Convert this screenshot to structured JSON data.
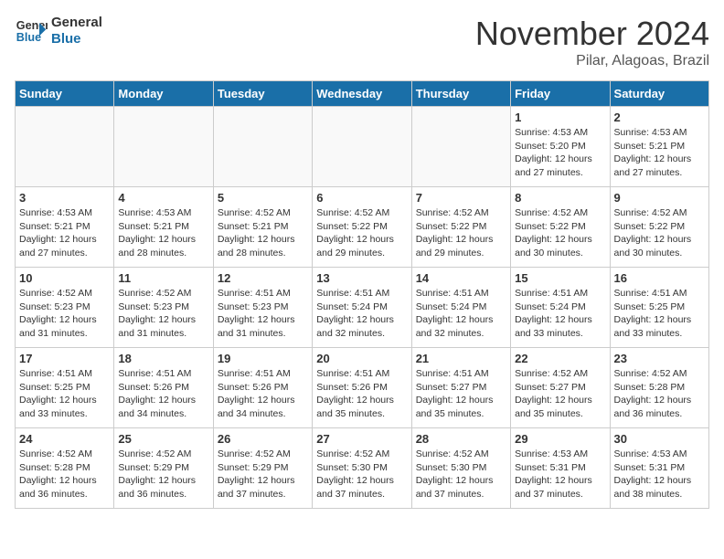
{
  "header": {
    "logo_line1": "General",
    "logo_line2": "Blue",
    "month": "November 2024",
    "location": "Pilar, Alagoas, Brazil"
  },
  "days_of_week": [
    "Sunday",
    "Monday",
    "Tuesday",
    "Wednesday",
    "Thursday",
    "Friday",
    "Saturday"
  ],
  "weeks": [
    [
      {
        "day": "",
        "info": ""
      },
      {
        "day": "",
        "info": ""
      },
      {
        "day": "",
        "info": ""
      },
      {
        "day": "",
        "info": ""
      },
      {
        "day": "",
        "info": ""
      },
      {
        "day": "1",
        "info": "Sunrise: 4:53 AM\nSunset: 5:20 PM\nDaylight: 12 hours and 27 minutes."
      },
      {
        "day": "2",
        "info": "Sunrise: 4:53 AM\nSunset: 5:21 PM\nDaylight: 12 hours and 27 minutes."
      }
    ],
    [
      {
        "day": "3",
        "info": "Sunrise: 4:53 AM\nSunset: 5:21 PM\nDaylight: 12 hours and 27 minutes."
      },
      {
        "day": "4",
        "info": "Sunrise: 4:53 AM\nSunset: 5:21 PM\nDaylight: 12 hours and 28 minutes."
      },
      {
        "day": "5",
        "info": "Sunrise: 4:52 AM\nSunset: 5:21 PM\nDaylight: 12 hours and 28 minutes."
      },
      {
        "day": "6",
        "info": "Sunrise: 4:52 AM\nSunset: 5:22 PM\nDaylight: 12 hours and 29 minutes."
      },
      {
        "day": "7",
        "info": "Sunrise: 4:52 AM\nSunset: 5:22 PM\nDaylight: 12 hours and 29 minutes."
      },
      {
        "day": "8",
        "info": "Sunrise: 4:52 AM\nSunset: 5:22 PM\nDaylight: 12 hours and 30 minutes."
      },
      {
        "day": "9",
        "info": "Sunrise: 4:52 AM\nSunset: 5:22 PM\nDaylight: 12 hours and 30 minutes."
      }
    ],
    [
      {
        "day": "10",
        "info": "Sunrise: 4:52 AM\nSunset: 5:23 PM\nDaylight: 12 hours and 31 minutes."
      },
      {
        "day": "11",
        "info": "Sunrise: 4:52 AM\nSunset: 5:23 PM\nDaylight: 12 hours and 31 minutes."
      },
      {
        "day": "12",
        "info": "Sunrise: 4:51 AM\nSunset: 5:23 PM\nDaylight: 12 hours and 31 minutes."
      },
      {
        "day": "13",
        "info": "Sunrise: 4:51 AM\nSunset: 5:24 PM\nDaylight: 12 hours and 32 minutes."
      },
      {
        "day": "14",
        "info": "Sunrise: 4:51 AM\nSunset: 5:24 PM\nDaylight: 12 hours and 32 minutes."
      },
      {
        "day": "15",
        "info": "Sunrise: 4:51 AM\nSunset: 5:24 PM\nDaylight: 12 hours and 33 minutes."
      },
      {
        "day": "16",
        "info": "Sunrise: 4:51 AM\nSunset: 5:25 PM\nDaylight: 12 hours and 33 minutes."
      }
    ],
    [
      {
        "day": "17",
        "info": "Sunrise: 4:51 AM\nSunset: 5:25 PM\nDaylight: 12 hours and 33 minutes."
      },
      {
        "day": "18",
        "info": "Sunrise: 4:51 AM\nSunset: 5:26 PM\nDaylight: 12 hours and 34 minutes."
      },
      {
        "day": "19",
        "info": "Sunrise: 4:51 AM\nSunset: 5:26 PM\nDaylight: 12 hours and 34 minutes."
      },
      {
        "day": "20",
        "info": "Sunrise: 4:51 AM\nSunset: 5:26 PM\nDaylight: 12 hours and 35 minutes."
      },
      {
        "day": "21",
        "info": "Sunrise: 4:51 AM\nSunset: 5:27 PM\nDaylight: 12 hours and 35 minutes."
      },
      {
        "day": "22",
        "info": "Sunrise: 4:52 AM\nSunset: 5:27 PM\nDaylight: 12 hours and 35 minutes."
      },
      {
        "day": "23",
        "info": "Sunrise: 4:52 AM\nSunset: 5:28 PM\nDaylight: 12 hours and 36 minutes."
      }
    ],
    [
      {
        "day": "24",
        "info": "Sunrise: 4:52 AM\nSunset: 5:28 PM\nDaylight: 12 hours and 36 minutes."
      },
      {
        "day": "25",
        "info": "Sunrise: 4:52 AM\nSunset: 5:29 PM\nDaylight: 12 hours and 36 minutes."
      },
      {
        "day": "26",
        "info": "Sunrise: 4:52 AM\nSunset: 5:29 PM\nDaylight: 12 hours and 37 minutes."
      },
      {
        "day": "27",
        "info": "Sunrise: 4:52 AM\nSunset: 5:30 PM\nDaylight: 12 hours and 37 minutes."
      },
      {
        "day": "28",
        "info": "Sunrise: 4:52 AM\nSunset: 5:30 PM\nDaylight: 12 hours and 37 minutes."
      },
      {
        "day": "29",
        "info": "Sunrise: 4:53 AM\nSunset: 5:31 PM\nDaylight: 12 hours and 37 minutes."
      },
      {
        "day": "30",
        "info": "Sunrise: 4:53 AM\nSunset: 5:31 PM\nDaylight: 12 hours and 38 minutes."
      }
    ]
  ]
}
